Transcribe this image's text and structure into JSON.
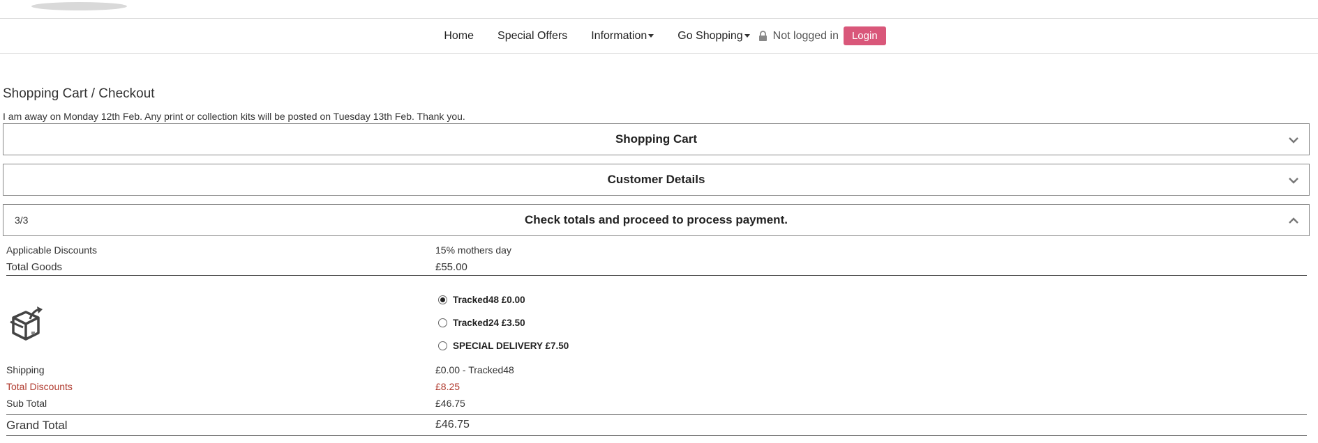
{
  "nav": {
    "items": [
      "Home",
      "Special Offers",
      "Information",
      "Go Shopping"
    ],
    "status": "Not logged in",
    "login_label": "Login"
  },
  "page": {
    "title": "Shopping Cart / Checkout",
    "notice": "I am away on Monday 12th Feb. Any print or collection kits will be posted on Tuesday 13th Feb. Thank you."
  },
  "panels": {
    "cart": "Shopping Cart",
    "customer": "Customer Details",
    "totals": "Check totals and proceed to process payment.",
    "step": "3/3"
  },
  "summary": {
    "discounts_label": "Applicable Discounts",
    "discounts_value": "15% mothers day",
    "goods_label": "Total Goods",
    "goods_value": "£55.00",
    "shipping_label": "Shipping",
    "shipping_value": "£0.00 - Tracked48",
    "total_discounts_label": "Total Discounts",
    "total_discounts_value": "£8.25",
    "subtotal_label": "Sub Total",
    "subtotal_value": "£46.75",
    "grand_label": "Grand Total",
    "grand_value": "£46.75"
  },
  "shipping_options": [
    {
      "label": "Tracked48 £0.00",
      "selected": true
    },
    {
      "label": "Tracked24 £3.50",
      "selected": false
    },
    {
      "label": "SPECIAL DELIVERY £7.50",
      "selected": false
    }
  ],
  "icons": {
    "lock": "lock-icon",
    "package": "package-icon",
    "chevron": "chevron-icon"
  },
  "colors": {
    "login_button": "#d9577a",
    "discount_text": "#b03a2e"
  }
}
